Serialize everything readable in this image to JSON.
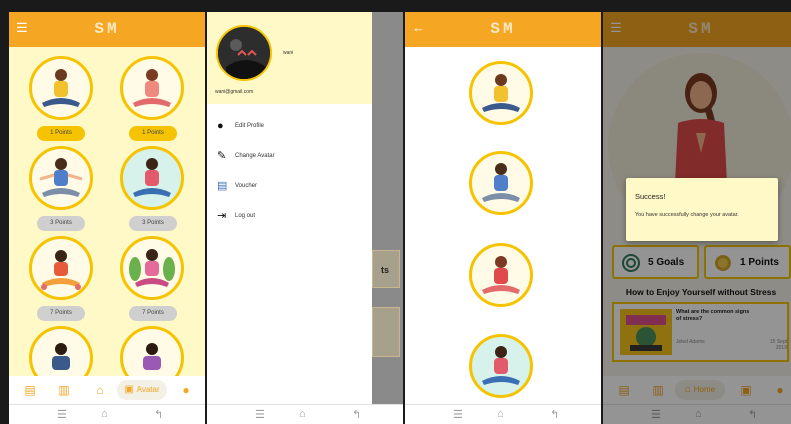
{
  "app": {
    "logo": "SM"
  },
  "avatar_list": {
    "points": [
      "1 Points",
      "1 Points",
      "3 Points",
      "3 Points",
      "7 Points",
      "7 Points"
    ]
  },
  "bottom_nav": {
    "active_label": "Avatar",
    "home_label": "Home"
  },
  "drawer": {
    "username": "wani",
    "email": "wani@gmail.com",
    "items": [
      {
        "label": "Edit Profile",
        "icon": "account-icon"
      },
      {
        "label": "Change Avatar",
        "icon": "pencil-icon"
      },
      {
        "label": "Voucher",
        "icon": "voucher-icon"
      },
      {
        "label": "Log out",
        "icon": "logout-icon"
      }
    ]
  },
  "home": {
    "goals": "5 Goals",
    "points": "1 Points",
    "section_title": "How to Enjoy Yourself without Stress",
    "article": {
      "title": "What are the common signs of stress?",
      "author": "Jeled Adams",
      "date": "15 Sept 2019"
    }
  },
  "dialog": {
    "title": "Success!",
    "message": "You have successfully change your avatar."
  },
  "colors": {
    "primary": "#f5a623",
    "accent": "#f5c300",
    "background": "#fff8c7"
  }
}
